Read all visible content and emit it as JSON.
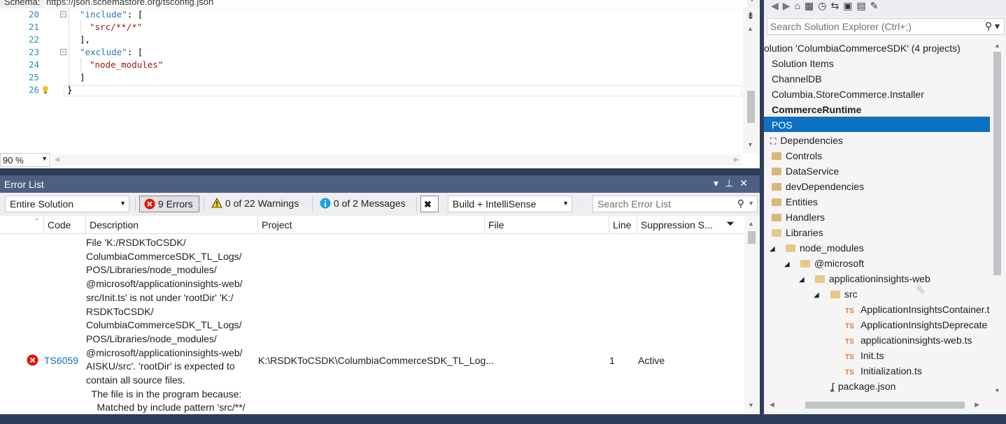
{
  "editor": {
    "schema_label": "Schema:",
    "schema_url": "https://json.schemastore.org/tsconfig.json",
    "line_numbers": [
      "20",
      "21",
      "22",
      "23",
      "24",
      "25",
      "26"
    ],
    "zoom": "90 %"
  },
  "error_list": {
    "title": "Error List",
    "scope": "Entire Solution",
    "errors_btn": "9 Errors",
    "warnings_btn": "0 of 22 Warnings",
    "messages_btn": "0 of 2 Messages",
    "build_filter": "Build + IntelliSense",
    "search_placeholder": "Search Error List",
    "columns": [
      "Code",
      "Description",
      "Project",
      "File",
      "Line",
      "Suppression S..."
    ],
    "row": {
      "code": "TS6059",
      "description_lines": [
        "File 'K:/RSDKToCSDK/",
        "ColumbiaCommerceSDK_TL_Logs/",
        "POS/Libraries/node_modules/",
        "@microsoft/applicationinsights-web/",
        "src/Init.ts' is not under 'rootDir' 'K:/",
        "RSDKToCSDK/",
        "ColumbiaCommerceSDK_TL_Logs/",
        "POS/Libraries/node_modules/",
        "@microsoft/applicationinsights-web/",
        "AISKU/src'. 'rootDir' is expected to",
        "contain all source files.",
        "  The file is in the program because:",
        "    Matched by include pattern 'src/**/"
      ],
      "project": "K:\\RSDKToCSDK\\ColumbiaCommerceSDK_TL_Log...",
      "line": "1",
      "suppression": "Active"
    }
  },
  "solution_explorer": {
    "search_placeholder": "Search Solution Explorer (Ctrl+;)",
    "items": [
      "olution 'ColumbiaCommerceSDK' (4 projects)",
      "Solution Items",
      "ChannelDB",
      "Columbia.StoreCommerce.Installer",
      "CommerceRuntime",
      "POS",
      "Dependencies",
      "Controls",
      "DataService",
      "devDependencies",
      "Entities",
      "Handlers",
      "Libraries",
      "node_modules",
      "@microsoft",
      "applicationinsights-web",
      "src",
      "ApplicationInsightsContainer.t",
      "ApplicationInsightsDeprecate",
      "applicationinsights-web.ts",
      "Init.ts",
      "Initialization.ts",
      "package.json"
    ]
  },
  "colors": {
    "accent": "#0e70c0",
    "title_bar": "#4d6082",
    "error_icon": "#e51400",
    "warning_icon": "#ffcc00",
    "info_icon": "#1ba1e2"
  }
}
